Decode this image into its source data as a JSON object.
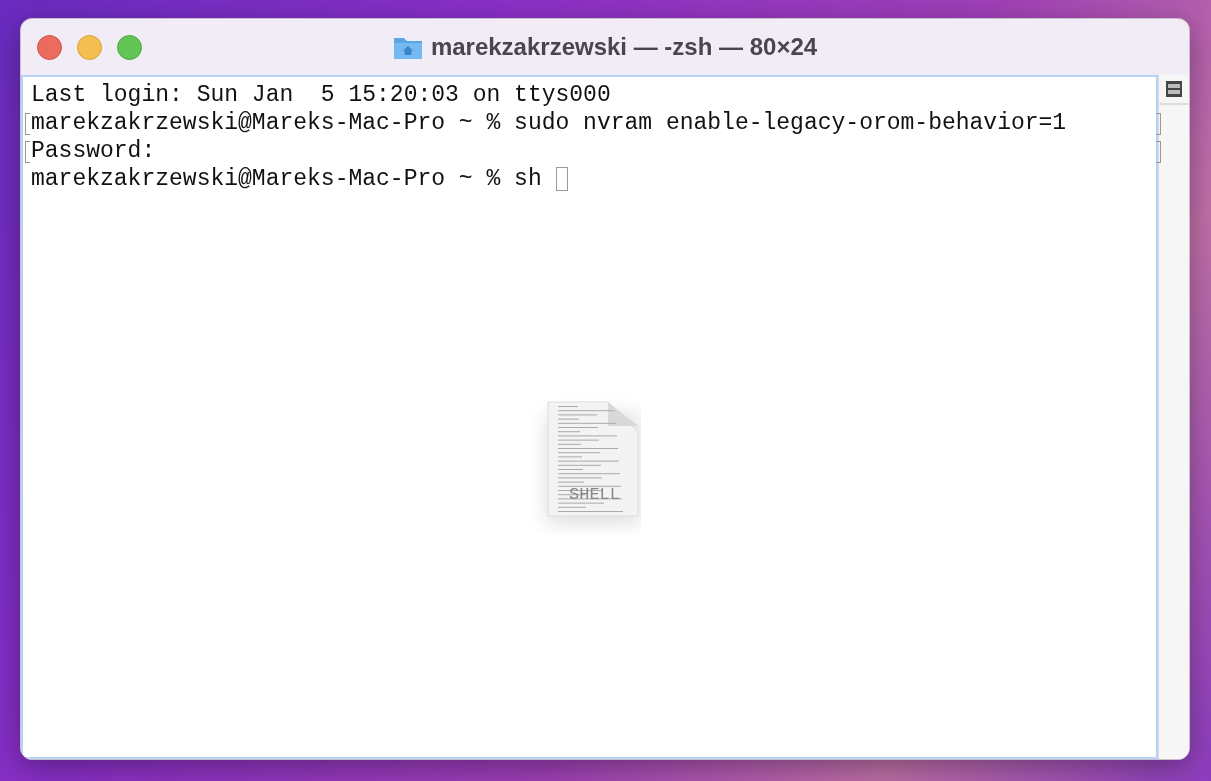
{
  "window": {
    "title": "marekzakrzewski — -zsh — 80×24"
  },
  "terminal": {
    "lines": [
      {
        "text": "Last login: Sun Jan  5 15:20:03 on ttys000",
        "marked": false,
        "cursor": false
      },
      {
        "text": "marekzakrzewski@Mareks-Mac-Pro ~ % sudo nvram enable-legacy-orom-behavior=1",
        "marked": true,
        "cursor": false
      },
      {
        "text": "Password:",
        "marked": true,
        "cursor": false
      },
      {
        "text": "marekzakrzewski@Mareks-Mac-Pro ~ % sh ",
        "marked": false,
        "cursor": true
      }
    ]
  },
  "drag_icon": {
    "label": "SHELL"
  }
}
